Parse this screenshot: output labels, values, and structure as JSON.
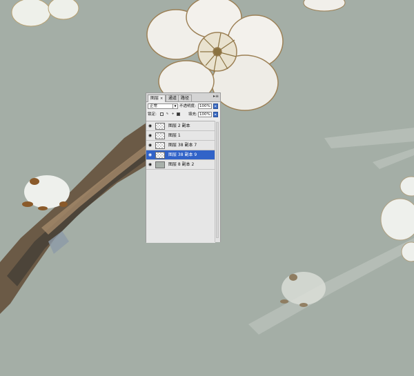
{
  "panel": {
    "tabs": [
      {
        "label": "图层",
        "close": "×",
        "active": true
      },
      {
        "label": "通道",
        "active": false
      },
      {
        "label": "路径",
        "active": false
      }
    ],
    "menu_glyph": "▸≡",
    "blend_mode": "正常",
    "opacity_label": "不透明度:",
    "opacity_value": "100%",
    "lock_label": "锁定:",
    "fill_label": "填充:",
    "fill_value": "100%",
    "layers": [
      {
        "name": "图层 2 副本",
        "selected": false,
        "thumb": "transparent"
      },
      {
        "name": "图层 1",
        "selected": false,
        "thumb": "transparent"
      },
      {
        "name": "图层 38 副本 7",
        "selected": false,
        "thumb": "transparent"
      },
      {
        "name": "图层 38 副本 9",
        "selected": true,
        "thumb": "transparent"
      },
      {
        "name": "图层 8 副本 2",
        "selected": false,
        "thumb": "gray"
      }
    ]
  },
  "colors": {
    "background": "#a4aea6",
    "selection": "#3163c8"
  }
}
